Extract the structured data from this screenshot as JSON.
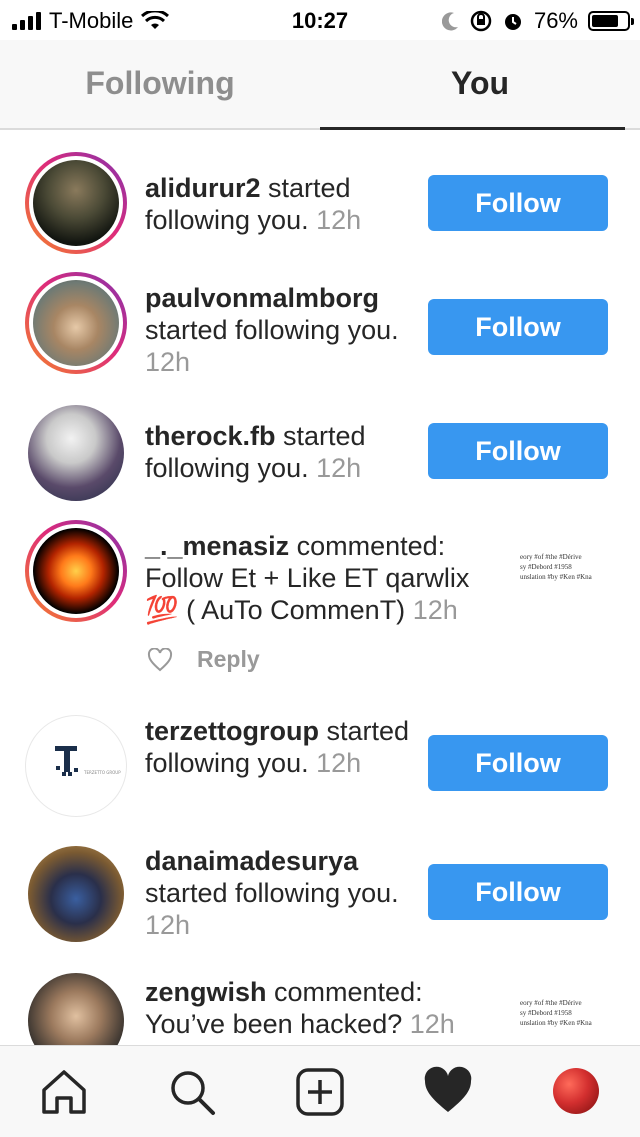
{
  "status_bar": {
    "carrier": "T-Mobile",
    "time": "10:27",
    "battery": "76%",
    "battery_level": 0.76
  },
  "tabs": [
    {
      "label": "Following",
      "active": false
    },
    {
      "label": "You",
      "active": true
    }
  ],
  "activity": [
    {
      "username": "alidurur2",
      "action": " started following you.",
      "time": " 12h",
      "button": "Follow",
      "ring": true
    },
    {
      "username": "paulvonmalmborg",
      "action": " started following you.",
      "time": " 12h",
      "button": "Follow",
      "ring": true
    },
    {
      "username": "therock.fb",
      "action": " started following you.",
      "time": " 12h",
      "button": "Follow",
      "ring": false
    },
    {
      "username": "_._menasiz",
      "action": " commented: Follow Et + Like ET qarwlix 💯 ( AuTo CommenT)",
      "time": " 12h",
      "reply": "Reply",
      "thumbnail_text": [
        "eory #of #the #Dérive",
        "sy #Debord #1958",
        "unslation #by #Ken #Kna"
      ],
      "ring": true
    },
    {
      "username": "terzettogroup",
      "action": " started following you.",
      "time": " 12h",
      "button": "Follow",
      "ring": false
    },
    {
      "username": "danaimadesurya",
      "action": " started following you.",
      "time": " 12h",
      "button": "Follow",
      "ring": false
    },
    {
      "username": "zengwish",
      "action": " commented: You’ve been hacked?",
      "time": " 12h",
      "thumbnail_text": [
        "eory #of #the #Dérive",
        "sy #Debord #1958",
        "unslation #by #Ken #Kna"
      ],
      "ring": false
    }
  ],
  "logo_text": "TERZETTO GROUP",
  "nav": [
    "home-icon",
    "search-icon",
    "add-post-icon",
    "heart-icon",
    "profile-avatar"
  ],
  "colors": {
    "accent": "#3897f0",
    "text": "#262626",
    "muted": "#999999"
  }
}
